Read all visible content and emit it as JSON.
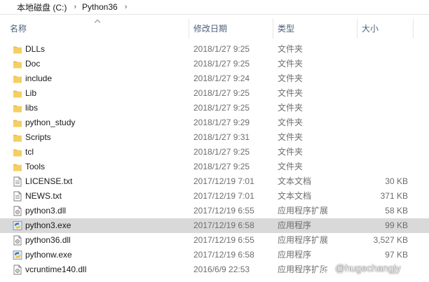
{
  "breadcrumb": [
    "本地磁盘 (C:)",
    "Python36"
  ],
  "columns": {
    "name": "名称",
    "date": "修改日期",
    "type": "类型",
    "size": "大小"
  },
  "files": [
    {
      "name": "DLLs",
      "date": "2018/1/27 9:25",
      "type": "文件夹",
      "size": "",
      "icon": "folder-icon"
    },
    {
      "name": "Doc",
      "date": "2018/1/27 9:25",
      "type": "文件夹",
      "size": "",
      "icon": "folder-icon"
    },
    {
      "name": "include",
      "date": "2018/1/27 9:24",
      "type": "文件夹",
      "size": "",
      "icon": "folder-icon"
    },
    {
      "name": "Lib",
      "date": "2018/1/27 9:25",
      "type": "文件夹",
      "size": "",
      "icon": "folder-icon"
    },
    {
      "name": "libs",
      "date": "2018/1/27 9:25",
      "type": "文件夹",
      "size": "",
      "icon": "folder-icon"
    },
    {
      "name": "python_study",
      "date": "2018/1/27 9:29",
      "type": "文件夹",
      "size": "",
      "icon": "folder-icon"
    },
    {
      "name": "Scripts",
      "date": "2018/1/27 9:31",
      "type": "文件夹",
      "size": "",
      "icon": "folder-icon"
    },
    {
      "name": "tcl",
      "date": "2018/1/27 9:25",
      "type": "文件夹",
      "size": "",
      "icon": "folder-icon"
    },
    {
      "name": "Tools",
      "date": "2018/1/27 9:25",
      "type": "文件夹",
      "size": "",
      "icon": "folder-icon"
    },
    {
      "name": "LICENSE.txt",
      "date": "2017/12/19 7:01",
      "type": "文本文档",
      "size": "30 KB",
      "icon": "text-file-icon"
    },
    {
      "name": "NEWS.txt",
      "date": "2017/12/19 7:01",
      "type": "文本文档",
      "size": "371 KB",
      "icon": "text-file-icon"
    },
    {
      "name": "python3.dll",
      "date": "2017/12/19 6:55",
      "type": "应用程序扩展",
      "size": "58 KB",
      "icon": "dll-file-icon"
    },
    {
      "name": "python3.exe",
      "date": "2017/12/19 6:58",
      "type": "应用程序",
      "size": "99 KB",
      "icon": "python-exe-icon",
      "selected": true
    },
    {
      "name": "python36.dll",
      "date": "2017/12/19 6:55",
      "type": "应用程序扩展",
      "size": "3,527 KB",
      "icon": "dll-file-icon"
    },
    {
      "name": "pythonw.exe",
      "date": "2017/12/19 6:58",
      "type": "应用程序",
      "size": "97 KB",
      "icon": "python-exe-icon"
    },
    {
      "name": "vcruntime140.dll",
      "date": "2016/6/9 22:53",
      "type": "应用程序扩展",
      "size": "",
      "icon": "dll-file-icon"
    }
  ],
  "watermark": "@hugechangjy",
  "colors": {
    "folder": "#e8bd4c",
    "selected_row": "#d9d9d9",
    "header_text": "#4c607a"
  }
}
